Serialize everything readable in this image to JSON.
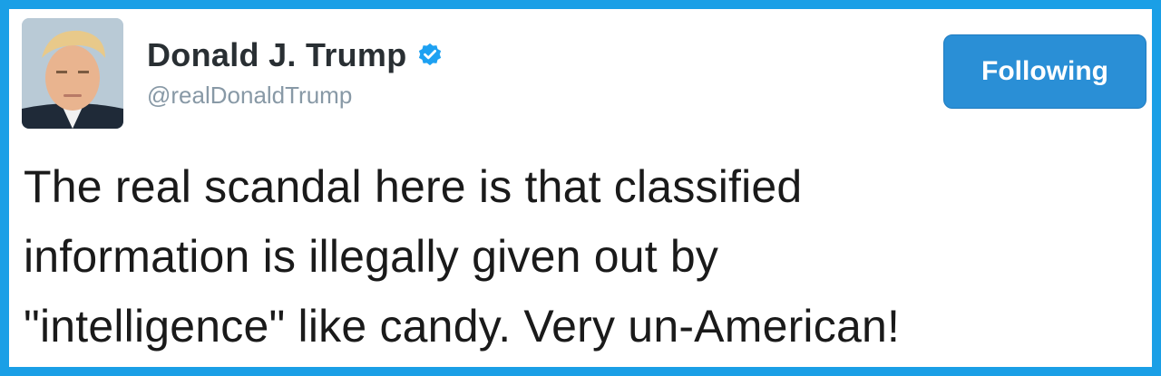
{
  "tweet": {
    "author": {
      "display_name": "Donald J. Trump",
      "handle": "@realDonaldTrump",
      "verified": true
    },
    "follow_button_label": "Following",
    "text": "The real scandal here is that classified\ninformation is illegally given out by\n\"intelligence\" like candy. Very un-American!"
  },
  "colors": {
    "frame_border": "#1a9fe6",
    "follow_button_bg": "#2a8fd6",
    "verified_badge": "#1da1f2",
    "display_name": "#292f33",
    "handle": "#8899a6",
    "text": "#1a1a1a"
  },
  "icons": {
    "verified": "verified-badge-icon"
  }
}
